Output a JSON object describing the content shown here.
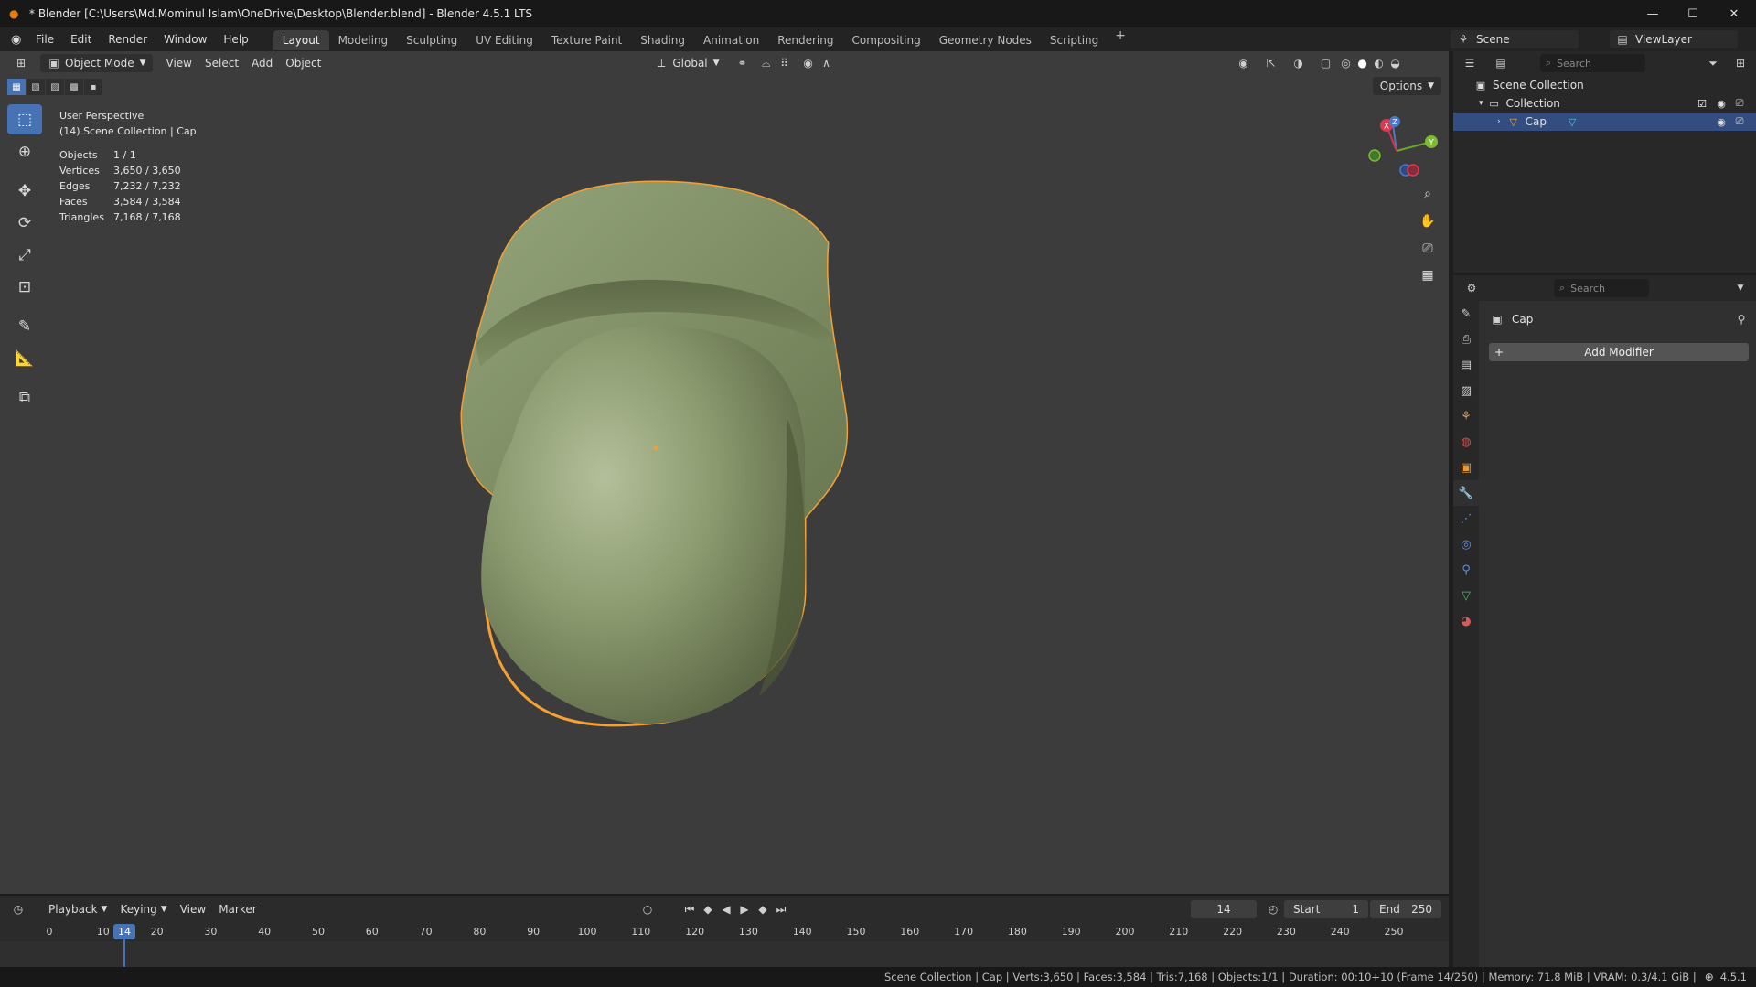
{
  "window": {
    "title": "* Blender [C:\\Users\\Md.Mominul Islam\\OneDrive\\Desktop\\Blender.blend] - Blender 4.5.1 LTS",
    "controls": [
      "minimize-icon",
      "maximize-icon",
      "close-icon"
    ]
  },
  "menu": {
    "items": [
      "File",
      "Edit",
      "Render",
      "Window",
      "Help"
    ]
  },
  "workspaces": {
    "tabs": [
      "Layout",
      "Modeling",
      "Sculpting",
      "UV Editing",
      "Texture Paint",
      "Shading",
      "Animation",
      "Rendering",
      "Compositing",
      "Geometry Nodes",
      "Scripting"
    ],
    "active": "Layout"
  },
  "scene": {
    "label": "Scene",
    "viewlayer": "ViewLayer"
  },
  "viewport_header": {
    "mode": "Object Mode",
    "menus": [
      "View",
      "Select",
      "Add",
      "Object"
    ],
    "transform_orientation": "Global",
    "options": "Options"
  },
  "viewport_overlay": {
    "perspective": "User Perspective",
    "context": "(14) Scene Collection | Cap",
    "stats": [
      {
        "key": "Objects",
        "value": "1 / 1"
      },
      {
        "key": "Vertices",
        "value": "3,650 / 3,650"
      },
      {
        "key": "Edges",
        "value": "7,232 / 7,232"
      },
      {
        "key": "Faces",
        "value": "3,584 / 3,584"
      },
      {
        "key": "Triangles",
        "value": "7,168 / 7,168"
      }
    ],
    "gizmo_axes": {
      "x": "X",
      "y": "Y",
      "z": "Z"
    }
  },
  "colors": {
    "accent": "#4772b3",
    "selection_outline": "#f5a033",
    "mesh": "#8ea071",
    "viewport_bg": "#3c3c3c"
  },
  "timeline": {
    "menus": [
      "Playback",
      "Keying",
      "View",
      "Marker"
    ],
    "current_frame": "14",
    "start_label": "Start",
    "start": "1",
    "end_label": "End",
    "end": "250",
    "ticks": [
      "0",
      "10",
      "20",
      "30",
      "40",
      "50",
      "60",
      "70",
      "80",
      "90",
      "100",
      "110",
      "120",
      "130",
      "140",
      "150",
      "160",
      "170",
      "180",
      "190",
      "200",
      "210",
      "220",
      "230",
      "240",
      "250"
    ]
  },
  "statusbar": {
    "text": "Scene Collection | Cap | Verts:3,650 | Faces:3,584 | Tris:7,168 | Objects:1/1 | Duration: 00:10+10 (Frame 14/250) | Memory: 71.8 MiB | VRAM: 0.3/4.1 GiB |",
    "version": "4.5.1"
  },
  "outliner": {
    "search_placeholder": "Search",
    "scene_collection": "Scene Collection",
    "collection": "Collection",
    "object": "Cap"
  },
  "properties": {
    "search_placeholder": "Search",
    "object_name": "Cap",
    "add_modifier": "Add Modifier"
  }
}
